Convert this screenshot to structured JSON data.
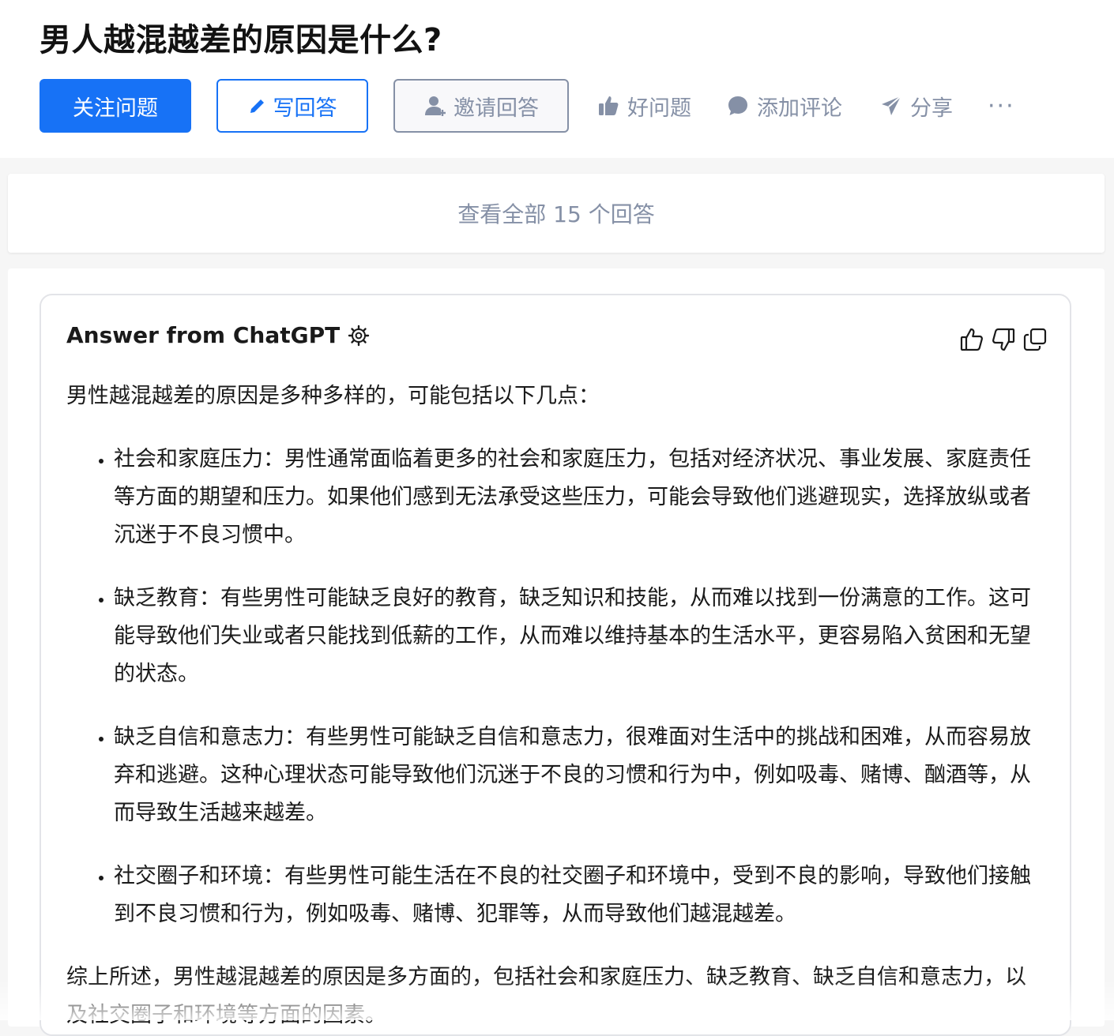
{
  "question": {
    "title": "男人越混越差的原因是什么?"
  },
  "actions": {
    "follow_label": "关注问题",
    "write_label": "写回答",
    "invite_label": "邀请回答",
    "good_question_label": "好问题",
    "add_comment_label": "添加评论",
    "share_label": "分享",
    "more_label": "···"
  },
  "view_all": {
    "label": "查看全部 15 个回答"
  },
  "chatgpt": {
    "header": "Answer from ChatGPT",
    "intro": "男性越混越差的原因是多种多样的，可能包括以下几点：",
    "points": [
      "社会和家庭压力：男性通常面临着更多的社会和家庭压力，包括对经济状况、事业发展、家庭责任等方面的期望和压力。如果他们感到无法承受这些压力，可能会导致他们逃避现实，选择放纵或者沉迷于不良习惯中。",
      "缺乏教育：有些男性可能缺乏良好的教育，缺乏知识和技能，从而难以找到一份满意的工作。这可能导致他们失业或者只能找到低薪的工作，从而难以维持基本的生活水平，更容易陷入贫困和无望的状态。",
      "缺乏自信和意志力：有些男性可能缺乏自信和意志力，很难面对生活中的挑战和困难，从而容易放弃和逃避。这种心理状态可能导致他们沉迷于不良的习惯和行为中，例如吸毒、赌博、酗酒等，从而导致生活越来越差。",
      "社交圈子和环境：有些男性可能生活在不良的社交圈子和环境中，受到不良的影响，导致他们接触到不良习惯和行为，例如吸毒、赌博、犯罪等，从而导致他们越混越差。"
    ],
    "conclusion": "综上所述，男性越混越差的原因是多方面的，包括社会和家庭压力、缺乏教育、缺乏自信和意志力，以及社交圈子和环境等方面的因素。"
  },
  "colors": {
    "primary": "#1772f6",
    "muted": "#8590a6",
    "background": "#f6f6f6"
  },
  "icons": [
    "pencil-icon",
    "invite-user-icon",
    "thumbs-up-icon",
    "comment-bubble-icon",
    "share-plane-icon",
    "gear-icon",
    "like-icon",
    "dislike-icon",
    "copy-icon"
  ]
}
